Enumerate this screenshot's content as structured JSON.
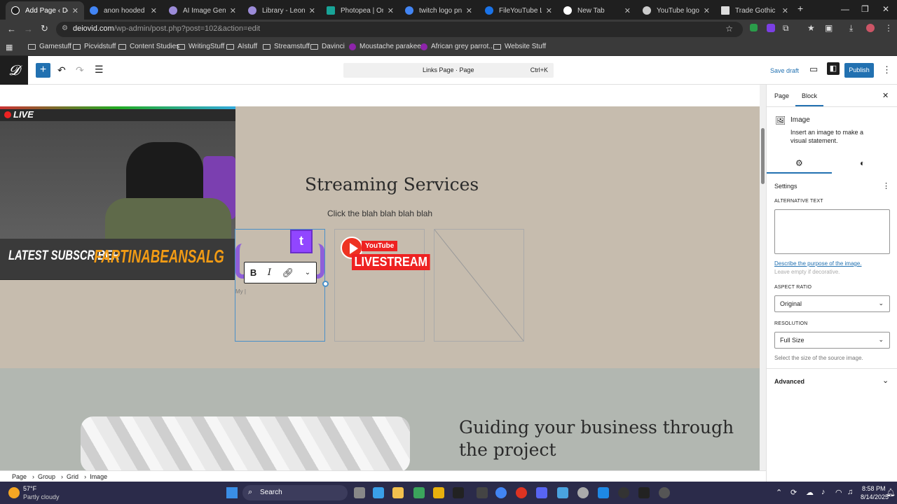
{
  "browser": {
    "tabs": [
      {
        "title": "Add Page ‹ Deiovi",
        "active": true,
        "color": "#ffffff"
      },
      {
        "title": "anon hooded per",
        "color": "#4285f4"
      },
      {
        "title": "AI Image Generat",
        "color": "#9b8bd8"
      },
      {
        "title": "Library - Leonardo",
        "color": "#9b8bd8"
      },
      {
        "title": "Photopea | Online",
        "color": "#18a497"
      },
      {
        "title": "twitch logo png -",
        "color": "#4285f4"
      },
      {
        "title": "FileYouTube Live",
        "color": "#1a73e8"
      },
      {
        "title": "New Tab",
        "color": "#ffffff"
      },
      {
        "title": "YouTube logo fon",
        "color": "#cccccc"
      },
      {
        "title": "Trade Gothic Bold",
        "color": "#dddddd"
      }
    ],
    "new_tab": "+",
    "url_domain": "deiovid.com",
    "url_path": "/wp-admin/post.php?post=102&action=edit",
    "bookmarks": [
      "Gamestuff",
      "Picvidstuff",
      "Content Studies",
      "WritingStuff",
      "AIstuff",
      "Streamstuff",
      "Davinci",
      "Moustache parakee...",
      "African grey parrot...",
      "Website Stuff"
    ]
  },
  "wp": {
    "command_title": "Links Page · Page",
    "command_shortcut": "Ctrl+K",
    "save_draft": "Save draft",
    "publish": "Publish",
    "brand_color": "#2271b1"
  },
  "content": {
    "heading": "Streaming Services",
    "subtext": "Click the blah blah blah blah",
    "caption_placeholder": "My |",
    "stream_live": "LIVE",
    "latest_subscriber_label": "LATEST SUBSCRIBER",
    "latest_subscriber_name": "FARTINABEANSALG",
    "twitch_letter": "t",
    "youtube_text": "YouTube",
    "livestream_text": "LIVESTREAM",
    "heading2": "Guiding your business through the project"
  },
  "sidebar": {
    "tab_page": "Page",
    "tab_block": "Block",
    "block_name": "Image",
    "block_desc": "Insert an image to make a visual statement.",
    "settings": "Settings",
    "alt_label": "ALTERNATIVE TEXT",
    "alt_link": "Describe the purpose of the image.",
    "alt_hint": "Leave empty if decorative.",
    "aspect_label": "ASPECT RATIO",
    "aspect_value": "Original",
    "resolution_label": "RESOLUTION",
    "resolution_value": "Full Size",
    "resolution_hint": "Select the size of the source image.",
    "advanced": "Advanced"
  },
  "breadcrumb": [
    "Page",
    "Group",
    "Grid",
    "Image"
  ],
  "taskbar": {
    "temp": "57°F",
    "weather": "Partly cloudy",
    "search": "Search",
    "time": "8:58 PM",
    "date": "8/14/2025"
  }
}
